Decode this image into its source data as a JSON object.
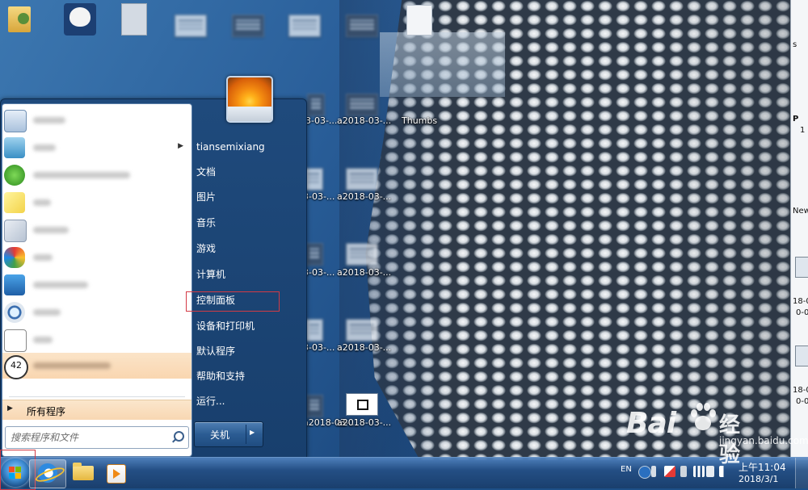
{
  "desktop": {
    "labels": {
      "thumbs": "Thumbs",
      "a1": "a2018-03-...",
      "a2": "a2018-03-...",
      "a3": "a2018-03-...",
      "a4": "a2018-03-...",
      "a5": "a2018-03-...",
      "p1": "-03-...",
      "p2": "a2018-03-...",
      "p3": "a2018-03-...",
      "p4": "a2018-03-...",
      "p5": "a2018-03-...",
      "r2": "3-03-...",
      "r3": "3-03-...",
      "r4": "3-03-...",
      "r5": "3-03-..."
    },
    "right_strip": {
      "s": "s",
      "p": "P",
      "one": "1",
      "new": "New",
      "d1": "18-0",
      "d2": "0-0",
      "d3": "18-0",
      "d4": "0-0"
    }
  },
  "start_menu": {
    "user_name": "tiansemixiang",
    "right_links": [
      "文档",
      "图片",
      "音乐",
      "游戏",
      "计算机",
      "控制面板",
      "设备和打印机",
      "默认程序",
      "帮助和支持",
      "运行..."
    ],
    "all_programs": "所有程序",
    "search_placeholder": "搜索程序和文件",
    "shutdown": "关机",
    "recent_number_badge": "42"
  },
  "taskbar": {
    "language": "EN",
    "time": "上午11:04",
    "date": "2018/3/1"
  },
  "watermark": {
    "brand": "Bai",
    "suffix": "经验",
    "url": "jingyan.baidu.com"
  },
  "colors": {
    "highlight_box": "#d33a45",
    "start_menu_blue": "#1f4a7c",
    "hover_orange": "#f9d6b0"
  }
}
